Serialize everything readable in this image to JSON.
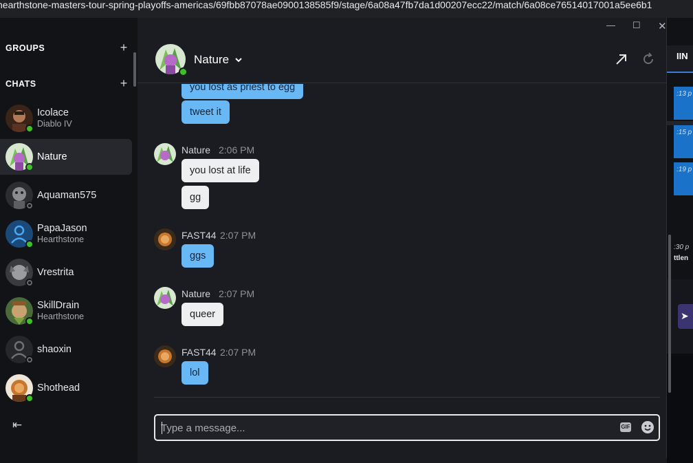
{
  "browser": {
    "url": "hearthstone-masters-tour-spring-playoffs-americas/69fbb87078ae0900138585f9/stage/6a08a47fb7da1d00207ecc22/match/6a08ce76514017001a5ee6b1"
  },
  "background_page": {
    "tab_label": "IIN",
    "msg_times": [
      ":13 p",
      ":15 p",
      ":19 p"
    ],
    "time_label": ":30 p",
    "bold_label": "ttlen"
  },
  "sidebar": {
    "groups_label": "GROUPS",
    "chats_label": "CHATS",
    "chats": [
      {
        "name": "Icolace",
        "subtitle": "Diablo IV",
        "online": true,
        "active": false
      },
      {
        "name": "Nature",
        "subtitle": "",
        "online": true,
        "active": true
      },
      {
        "name": "Aquaman575",
        "subtitle": "",
        "online": false,
        "active": false
      },
      {
        "name": "PapaJason",
        "subtitle": "Hearthstone",
        "online": true,
        "active": false
      },
      {
        "name": "Vrestrita",
        "subtitle": "",
        "online": false,
        "active": false
      },
      {
        "name": "SkillDrain",
        "subtitle": "Hearthstone",
        "online": true,
        "active": false
      },
      {
        "name": "shaoxin",
        "subtitle": "",
        "online": false,
        "active": false
      },
      {
        "name": "Shothead",
        "subtitle": "",
        "online": true,
        "active": false
      }
    ]
  },
  "header": {
    "name": "Nature"
  },
  "messages": {
    "top_partial": "you lost as priest to egg",
    "tweet": "tweet it",
    "groups": [
      {
        "author": "Nature",
        "time": "2:06 PM",
        "lines": [
          "you lost at life",
          "gg"
        ]
      },
      {
        "author": "FAST44",
        "time": "2:07 PM",
        "lines": [
          "ggs"
        ]
      },
      {
        "author": "Nature",
        "time": "2:07 PM",
        "lines": [
          "queer"
        ]
      },
      {
        "author": "FAST44",
        "time": "2:07 PM",
        "lines": [
          "lol"
        ]
      }
    ]
  },
  "composer": {
    "placeholder": "Type a message...",
    "gif_label": "GIF"
  },
  "colors": {
    "online": "#3fc02a",
    "bubble_blue": "#68b8f5",
    "bubble_white": "#eeeff1"
  }
}
